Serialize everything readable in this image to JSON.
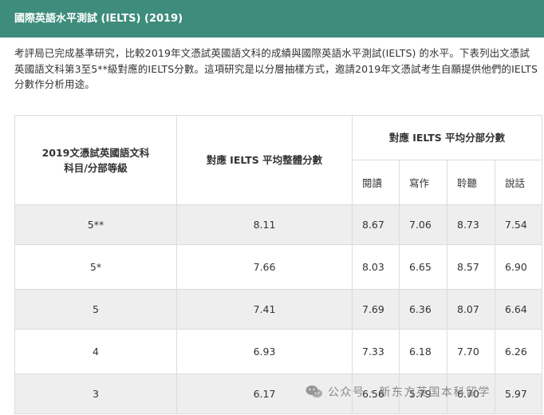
{
  "header": {
    "title": "國際英語水平測試 (IELTS) (2019)"
  },
  "intro": {
    "text": "考評局已完成基準研究，比較2019年文憑試英國語文科的成績與國際英語水平測試(IELTS) 的水平。下表列出文憑試英國語文科第3至5**級對應的IELTS分數。這項研究是以分層抽樣方式，邀請2019年文憑試考生自願提供他們的IELTS分數作分析用途。"
  },
  "table": {
    "col_level": "2019文憑試英國語文科\n科目/分部等級",
    "col_overall": "對應 IELTS 平均整體分數",
    "col_section_group": "對應 IELTS 平均分部分數",
    "sub_headers": [
      "閱讀",
      "寫作",
      "聆聽",
      "說話"
    ],
    "rows": [
      {
        "level": "5**",
        "overall": "8.11",
        "reading": "8.67",
        "writing": "7.06",
        "listening": "8.73",
        "speaking": "7.54"
      },
      {
        "level": "5*",
        "overall": "7.66",
        "reading": "8.03",
        "writing": "6.65",
        "listening": "8.57",
        "speaking": "6.90"
      },
      {
        "level": "5",
        "overall": "7.41",
        "reading": "7.69",
        "writing": "6.36",
        "listening": "8.07",
        "speaking": "6.64"
      },
      {
        "level": "4",
        "overall": "6.93",
        "reading": "7.33",
        "writing": "6.18",
        "listening": "7.70",
        "speaking": "6.26"
      },
      {
        "level": "3",
        "overall": "6.17",
        "reading": "6.56",
        "writing": "5.79",
        "listening": "6.70",
        "speaking": "5.97"
      }
    ]
  },
  "watermark": {
    "text": "公众号 · 新东方英国本科留学",
    "icon": "wechat-icon"
  },
  "colors": {
    "header_bg": "#3d8c7c",
    "row_shade": "#eeeeee"
  }
}
